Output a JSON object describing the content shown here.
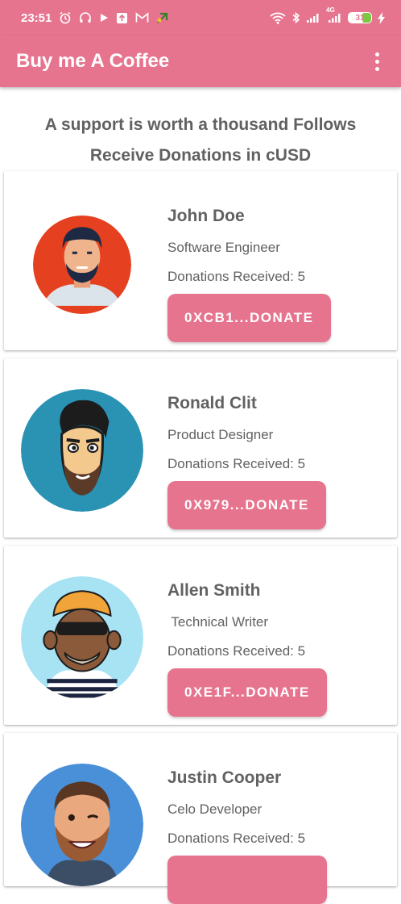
{
  "status_bar": {
    "time": "23:51",
    "network_primary": "4G",
    "battery_level": "31",
    "icons": [
      "alarm-icon",
      "headphones-icon",
      "play-icon",
      "upload-icon",
      "gmail-icon",
      "app-icon",
      "wifi-icon",
      "bluetooth-icon",
      "signal-icon",
      "signal-4g-icon",
      "battery-icon",
      "charging-icon"
    ]
  },
  "app_bar": {
    "title": "Buy me A Coffee",
    "menu_icon": "more-vert-icon"
  },
  "intro": {
    "line1": "A support is worth a thousand Follows",
    "line2": "Receive Donations in cUSD"
  },
  "colors": {
    "accent": "#e7748f",
    "text": "#616161"
  },
  "profiles": [
    {
      "name": "John Doe",
      "role": "Software Engineer",
      "donations": "Donations Received: 5",
      "button": "0XCB1...DONATE",
      "avatar_bg": "#e5401f"
    },
    {
      "name": "Ronald Clit",
      "role": "Product Designer",
      "donations": "Donations Received: 5",
      "button": "0X979...DONATE",
      "avatar_bg": "#2a93b3"
    },
    {
      "name": "Allen Smith",
      "role": " Technical Writer",
      "donations": "Donations Received: 5",
      "button": "0XE1F...DONATE",
      "avatar_bg": "#a8e3f4"
    },
    {
      "name": "Justin Cooper",
      "role": "Celo Developer",
      "donations": "Donations Received: 5",
      "button": "",
      "avatar_bg": "#4a90d9"
    }
  ]
}
